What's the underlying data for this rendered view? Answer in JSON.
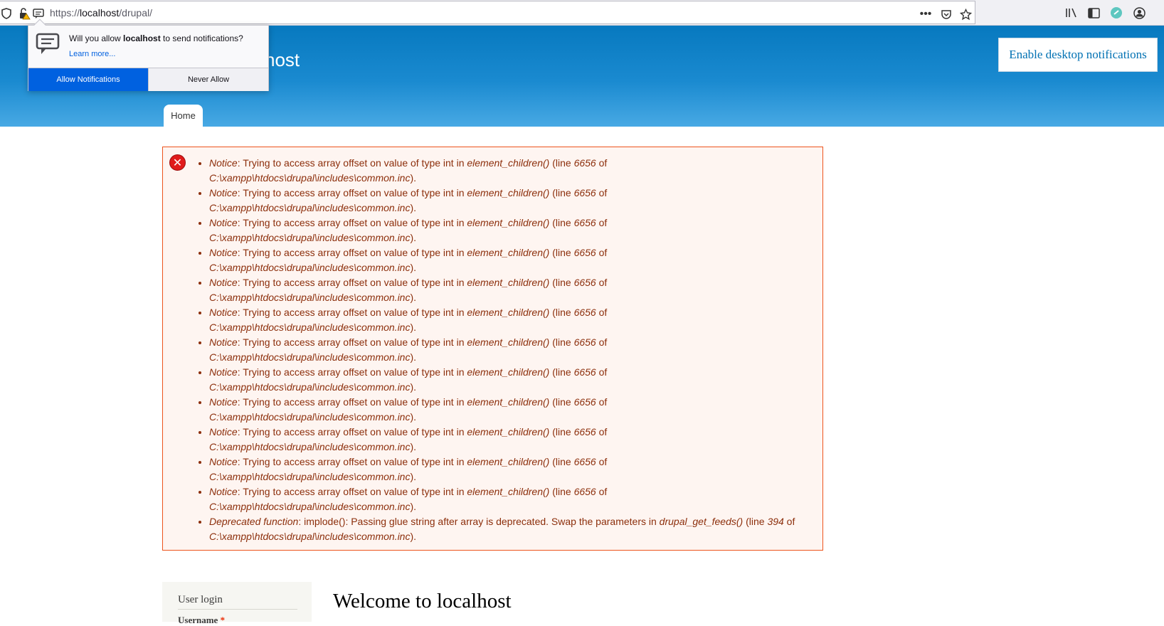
{
  "browser": {
    "url_scheme": "https://",
    "url_host": "localhost",
    "url_path": "/drupal/"
  },
  "notification_prompt": {
    "question_prefix": "Will you allow ",
    "question_host": "localhost",
    "question_suffix": " to send notifications?",
    "learn_more": "Learn more...",
    "allow_label": "Allow Notifications",
    "never_label": "Never Allow"
  },
  "header": {
    "site_name": "host",
    "enable_notifications": "Enable desktop notifications",
    "tabs": [
      {
        "label": "Home"
      }
    ]
  },
  "messages": {
    "notices": [
      {
        "type": "Notice",
        "text": ": Trying to access array offset on value of type int in ",
        "func": "element_children()",
        "mid": " (line ",
        "line": "6656",
        "of": " of ",
        "file": "C:\\xampp\\htdocs\\drupal\\includes\\common.inc",
        "end": ")."
      },
      {
        "type": "Notice",
        "text": ": Trying to access array offset on value of type int in ",
        "func": "element_children()",
        "mid": " (line ",
        "line": "6656",
        "of": " of ",
        "file": "C:\\xampp\\htdocs\\drupal\\includes\\common.inc",
        "end": ")."
      },
      {
        "type": "Notice",
        "text": ": Trying to access array offset on value of type int in ",
        "func": "element_children()",
        "mid": " (line ",
        "line": "6656",
        "of": " of ",
        "file": "C:\\xampp\\htdocs\\drupal\\includes\\common.inc",
        "end": ")."
      },
      {
        "type": "Notice",
        "text": ": Trying to access array offset on value of type int in ",
        "func": "element_children()",
        "mid": " (line ",
        "line": "6656",
        "of": " of ",
        "file": "C:\\xampp\\htdocs\\drupal\\includes\\common.inc",
        "end": ")."
      },
      {
        "type": "Notice",
        "text": ": Trying to access array offset on value of type int in ",
        "func": "element_children()",
        "mid": " (line ",
        "line": "6656",
        "of": " of ",
        "file": "C:\\xampp\\htdocs\\drupal\\includes\\common.inc",
        "end": ")."
      },
      {
        "type": "Notice",
        "text": ": Trying to access array offset on value of type int in ",
        "func": "element_children()",
        "mid": " (line ",
        "line": "6656",
        "of": " of ",
        "file": "C:\\xampp\\htdocs\\drupal\\includes\\common.inc",
        "end": ")."
      },
      {
        "type": "Notice",
        "text": ": Trying to access array offset on value of type int in ",
        "func": "element_children()",
        "mid": " (line ",
        "line": "6656",
        "of": " of ",
        "file": "C:\\xampp\\htdocs\\drupal\\includes\\common.inc",
        "end": ")."
      },
      {
        "type": "Notice",
        "text": ": Trying to access array offset on value of type int in ",
        "func": "element_children()",
        "mid": " (line ",
        "line": "6656",
        "of": " of ",
        "file": "C:\\xampp\\htdocs\\drupal\\includes\\common.inc",
        "end": ")."
      },
      {
        "type": "Notice",
        "text": ": Trying to access array offset on value of type int in ",
        "func": "element_children()",
        "mid": " (line ",
        "line": "6656",
        "of": " of ",
        "file": "C:\\xampp\\htdocs\\drupal\\includes\\common.inc",
        "end": ")."
      },
      {
        "type": "Notice",
        "text": ": Trying to access array offset on value of type int in ",
        "func": "element_children()",
        "mid": " (line ",
        "line": "6656",
        "of": " of ",
        "file": "C:\\xampp\\htdocs\\drupal\\includes\\common.inc",
        "end": ")."
      },
      {
        "type": "Notice",
        "text": ": Trying to access array offset on value of type int in ",
        "func": "element_children()",
        "mid": " (line ",
        "line": "6656",
        "of": " of ",
        "file": "C:\\xampp\\htdocs\\drupal\\includes\\common.inc",
        "end": ")."
      },
      {
        "type": "Notice",
        "text": ": Trying to access array offset on value of type int in ",
        "func": "element_children()",
        "mid": " (line ",
        "line": "6656",
        "of": " of ",
        "file": "C:\\xampp\\htdocs\\drupal\\includes\\common.inc",
        "end": ")."
      },
      {
        "type": "Deprecated function",
        "text": ": implode(): Passing glue string after array is deprecated. Swap the parameters in ",
        "func": "drupal_get_feeds()",
        "mid": " (line ",
        "line": "394",
        "of": " of ",
        "file": "C:\\xampp\\htdocs\\drupal\\includes\\common.inc",
        "end": ")."
      }
    ]
  },
  "sidebar": {
    "block_title": "User login",
    "username_label": "Username",
    "required_mark": "*"
  },
  "main": {
    "welcome_title": "Welcome to localhost"
  },
  "colors": {
    "header_blue": "#0779bf",
    "error_text": "#8c2e0b",
    "error_border": "#ed541d",
    "allow_button": "#0061e0"
  }
}
